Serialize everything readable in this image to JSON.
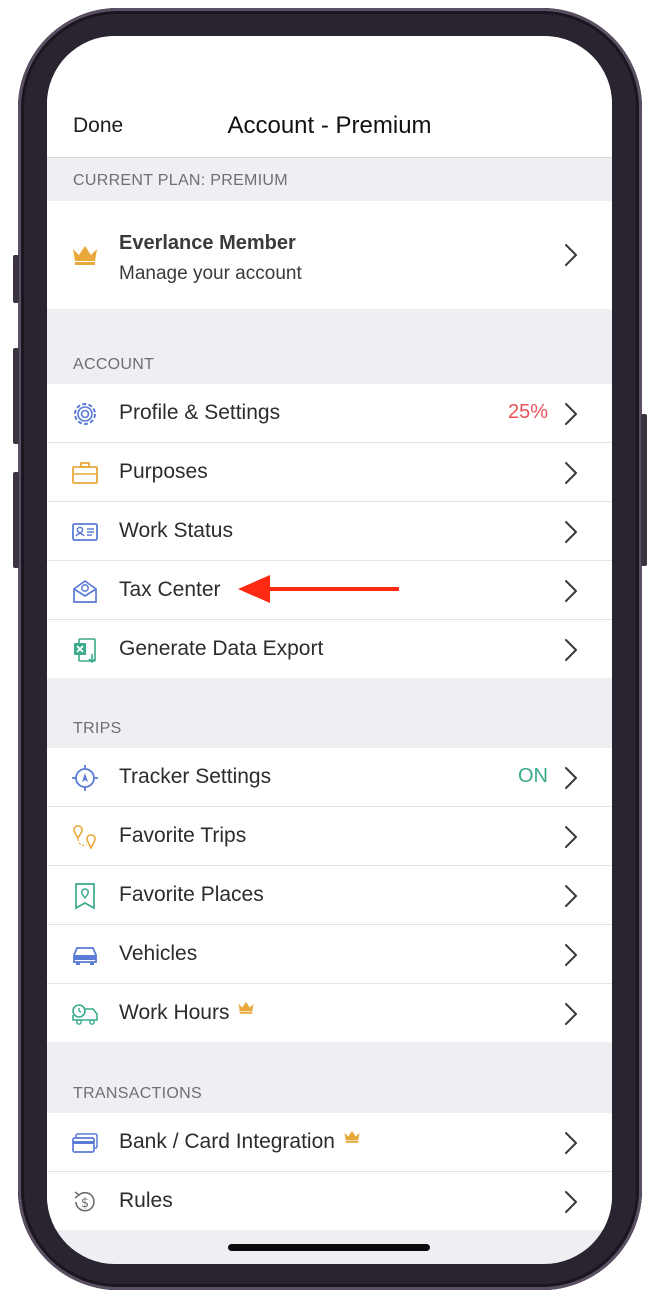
{
  "colors": {
    "accent_red": "#e8525b",
    "accent_green": "#3aaa8c",
    "crown": "#e8a93a",
    "annotation_arrow": "#ff2a12"
  },
  "nav": {
    "done_label": "Done",
    "title": "Account - Premium"
  },
  "current_plan": {
    "header": "CURRENT PLAN: PREMIUM",
    "member_title": "Everlance Member",
    "member_subtitle": "Manage your account",
    "icon": "crown-icon"
  },
  "account": {
    "header": "ACCOUNT",
    "items": [
      {
        "label": "Profile & Settings",
        "value": "25%",
        "icon": "gear-icon"
      },
      {
        "label": "Purposes",
        "icon": "briefcase-icon"
      },
      {
        "label": "Work Status",
        "icon": "id-card-icon"
      },
      {
        "label": "Tax Center",
        "icon": "tax-envelope-icon"
      },
      {
        "label": "Generate Data Export",
        "icon": "excel-export-icon"
      }
    ]
  },
  "trips": {
    "header": "TRIPS",
    "items": [
      {
        "label": "Tracker Settings",
        "value": "ON",
        "icon": "location-target-icon"
      },
      {
        "label": "Favorite Trips",
        "icon": "route-pins-icon"
      },
      {
        "label": "Favorite Places",
        "icon": "map-pin-icon"
      },
      {
        "label": "Vehicles",
        "icon": "car-icon"
      },
      {
        "label": "Work Hours",
        "icon": "clock-truck-icon",
        "premium": true
      }
    ]
  },
  "transactions": {
    "header": "TRANSACTIONS",
    "items": [
      {
        "label": "Bank / Card Integration",
        "icon": "credit-card-icon",
        "premium": true
      },
      {
        "label": "Rules",
        "icon": "dollar-rules-icon"
      }
    ]
  }
}
